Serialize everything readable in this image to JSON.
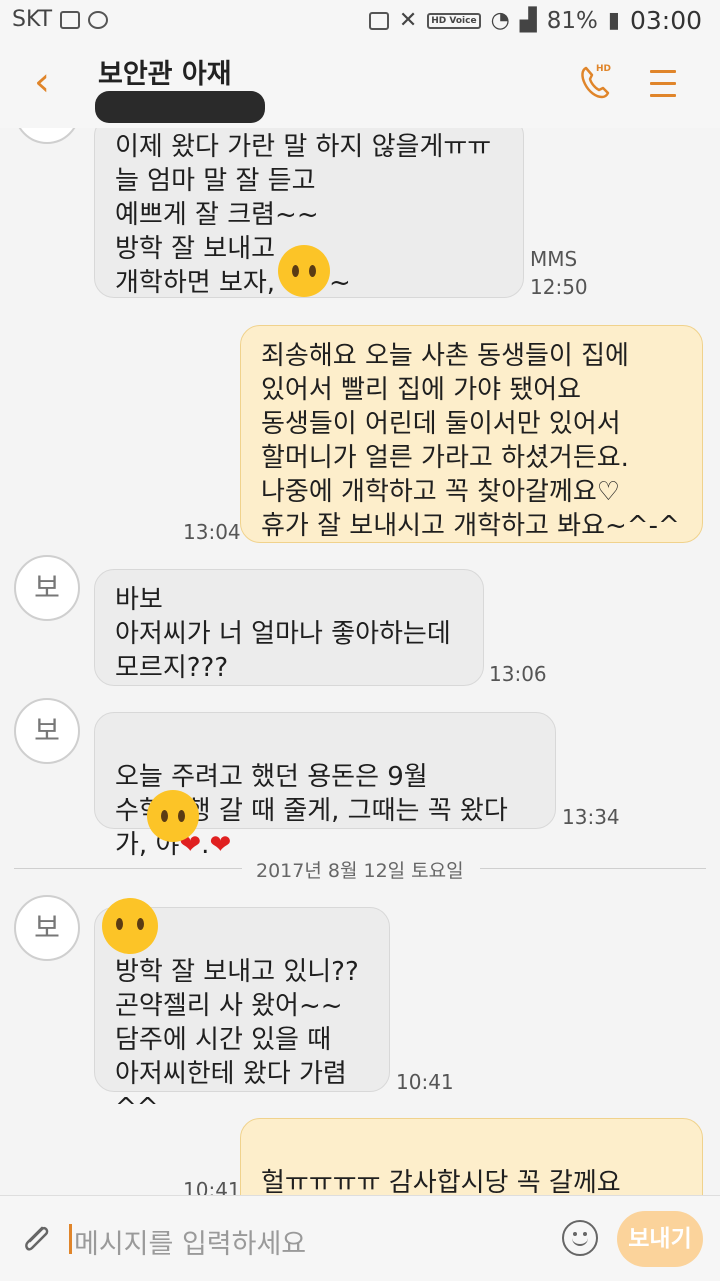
{
  "status": {
    "carrier": "SKT",
    "hd_voice": "HD Voice",
    "battery": "81%",
    "time": "03:00"
  },
  "header": {
    "title": "보안관 아재"
  },
  "messages": {
    "m1": {
      "text": "이제 왔다 가란 말 하지 않을게ㅠㅠ\n늘 엄마 말 잘 듣고\n예쁘게 잘 크렴~~\n방학 잘 보내고\n개학하면 보자,     야~~",
      "type": "MMS",
      "time": "12:50"
    },
    "m2": {
      "text": "죄송해요 오늘 사촌 동생들이 집에\n있어서 빨리 집에 가야 됐어요\n동생들이 어린데 둘이서만 있어서\n할머니가 얼른 가라고 하셨거든요.\n나중에 개학하고 꼭 찾아갈께요♡\n휴가 잘 보내시고 개학하고 봐요~^-^",
      "time": "13:04"
    },
    "m3": {
      "avatar": "보",
      "text": "바보\n아저씨가 너 얼마나 좋아하는데\n모르지???",
      "time": "13:06"
    },
    "m4": {
      "avatar": "보",
      "text_a": "오늘 주려고 했던 용돈은 9월\n수학여행 갈 때 줄게, 그때는 꼭 왔다\n가,     야",
      "heart1": "❤",
      "dot": ".",
      "heart2": "❤",
      "time": "13:34"
    },
    "date": "2017년 8월 12일 토요일",
    "m5": {
      "avatar": "보",
      "text": "     야\n방학 잘 보내고 있니??\n곤약젤리 사 왔어~~\n담주에 시간 있을 때\n아저씨한테 왔다 가렴^^",
      "time": "10:41"
    },
    "m6": {
      "text_a": "헐ㅠㅠㅠㅠ 감사합시당 꼭 갈께요\n나중에 뵈요",
      "emoji": "😍",
      "time": "10:41"
    }
  },
  "input": {
    "placeholder": "메시지를 입력하세요",
    "send": "보내기"
  },
  "colors": {
    "accent": "#e0852a",
    "out_bubble": "#fdeecb",
    "in_bubble": "#ececec"
  }
}
